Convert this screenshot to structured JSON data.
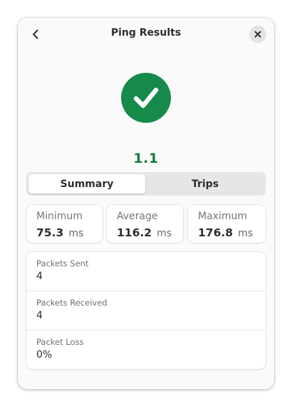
{
  "window": {
    "title": "Ping Results"
  },
  "icons": {
    "back": "go-previous-icon",
    "close": "window-close-icon",
    "status": "checkmark-success-icon"
  },
  "colors": {
    "success": "#168a4a",
    "success_text": "#137c41"
  },
  "result": {
    "host": "1.1"
  },
  "tabs": [
    {
      "label": "Summary",
      "active": true
    },
    {
      "label": "Trips",
      "active": false
    }
  ],
  "stats": {
    "minimum": {
      "label": "Minimum",
      "value": "75.3",
      "unit": "ms"
    },
    "average": {
      "label": "Average",
      "value": "116.2",
      "unit": "ms"
    },
    "maximum": {
      "label": "Maximum",
      "value": "176.8",
      "unit": "ms"
    }
  },
  "details": [
    {
      "label": "Packets Sent",
      "value": "4"
    },
    {
      "label": "Packets Received",
      "value": "4"
    },
    {
      "label": "Packet Loss",
      "value": "0%"
    }
  ]
}
